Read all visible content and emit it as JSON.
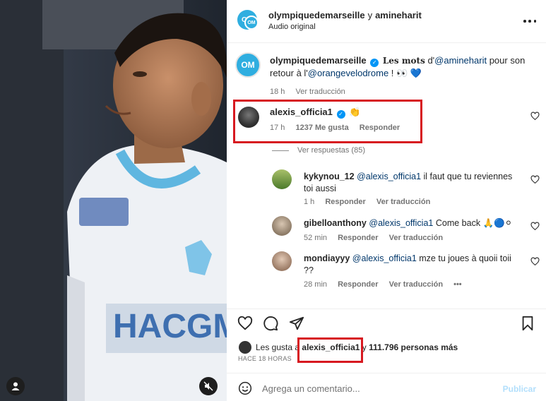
{
  "header": {
    "user1": "olympiquedemarseille",
    "connector": "y",
    "user2": "amineharit",
    "audio": "Audio original"
  },
  "caption": {
    "user": "olympiquedemarseille",
    "lead": "Les mots",
    "text_a": "d'",
    "mention1": "@amineharit",
    "text_b": "pour son retour à l'",
    "mention2": "@orangevelodrome",
    "text_c": "! 👀 💙",
    "time": "18 h",
    "translate": "Ver traducción"
  },
  "main_comment": {
    "user": "alexis_officia1",
    "emoji": "👏",
    "time": "17 h",
    "likes": "1237 Me gusta",
    "reply": "Responder",
    "view_replies": "Ver respuestas (85)"
  },
  "replies": [
    {
      "user": "kykynou_12",
      "mention": "@alexis_officia1",
      "text": "il faut que tu reviennes toi aussi",
      "time": "1 h",
      "reply": "Responder",
      "translate": "Ver traducción"
    },
    {
      "user": "gibelloanthony",
      "mention": "@alexis_officia1",
      "text": "Come back 🙏🔵⚪",
      "time": "52 min",
      "reply": "Responder",
      "translate": "Ver traducción"
    },
    {
      "user": "mondiayyy",
      "mention": "@alexis_officia1",
      "text": "mze tu joues à quoii toii ??",
      "time": "28 min",
      "reply": "Responder",
      "translate": "Ver traducción",
      "more": "•••"
    }
  ],
  "likes": {
    "prefix": "Les gusta a",
    "user": "alexis_officia1",
    "connector": "y",
    "count": "111.796 personas más"
  },
  "time_ago": "HACE 18 HORAS",
  "composer": {
    "placeholder": "Agrega un comentario...",
    "post": "Publicar"
  },
  "icons": [
    "heart-icon",
    "comment-icon",
    "share-icon",
    "bookmark-icon",
    "more-icon",
    "mute-icon",
    "user-tag-icon",
    "emoji-icon"
  ],
  "colors": {
    "highlight": "#d71920",
    "brand": "#2faee0",
    "link": "#00376b",
    "verified": "#0095f6"
  }
}
